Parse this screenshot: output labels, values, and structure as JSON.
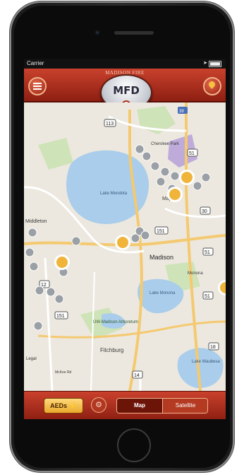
{
  "status": {
    "carrier": "Carrier",
    "time": ""
  },
  "header": {
    "org": "MADISON FIRE",
    "badge": "MFD"
  },
  "map": {
    "labels": [
      "Cherokee Park",
      "Lake Mendota",
      "Maple",
      "Middleton",
      "Madison",
      "Lake Monona",
      "UW-Madison Arboretum",
      "Fitchburg",
      "McKee Rd",
      "Lake Waubesa",
      "Monona"
    ],
    "shields": [
      "113",
      "39",
      "51",
      "30",
      "151",
      "51",
      "12",
      "151",
      "51",
      "14",
      "18"
    ],
    "legal": "Legal"
  },
  "toolbar": {
    "aeds_label": "AEDs",
    "map_label": "Map",
    "satellite_label": "Satellite"
  },
  "colors": {
    "accent": "#b43a22",
    "marker_active": "#f0b43a",
    "marker_inactive": "#9aa0a6"
  }
}
